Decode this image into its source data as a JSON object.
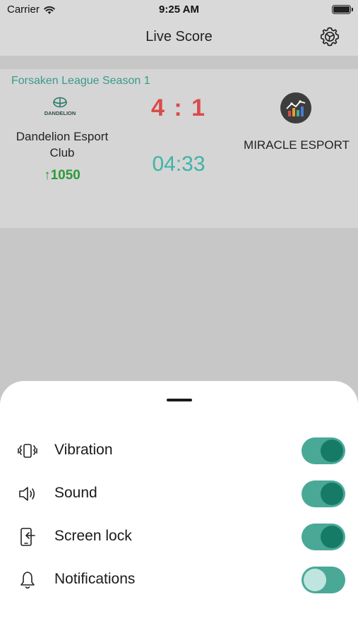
{
  "status_bar": {
    "carrier": "Carrier",
    "time": "9:25 AM"
  },
  "nav": {
    "title": "Live Score",
    "settings_icon": "gear-icon"
  },
  "match": {
    "league": "Forsaken League Season 1",
    "team_left": {
      "name": "Dandelion Esport Club",
      "logo_text": "DANDELION",
      "rank": "↑1050"
    },
    "score": "4 : 1",
    "timer": "04:33",
    "team_right": {
      "name": "MIRACLE ESPORT"
    }
  },
  "settings": [
    {
      "label": "Vibration",
      "icon": "vibration-icon",
      "enabled": true
    },
    {
      "label": "Sound",
      "icon": "speaker-icon",
      "enabled": true
    },
    {
      "label": "Screen lock",
      "icon": "screen-lock-icon",
      "enabled": true
    },
    {
      "label": "Notifications",
      "icon": "bell-icon",
      "enabled": false
    }
  ],
  "colors": {
    "accent": "#3a9a8c",
    "score": "#d94b4b",
    "timer": "#3fb3a6",
    "rank": "#2f9a3a",
    "toggle_track": "#4aa896",
    "toggle_knob_on": "#157b67",
    "toggle_knob_off": "#bfe6de"
  }
}
